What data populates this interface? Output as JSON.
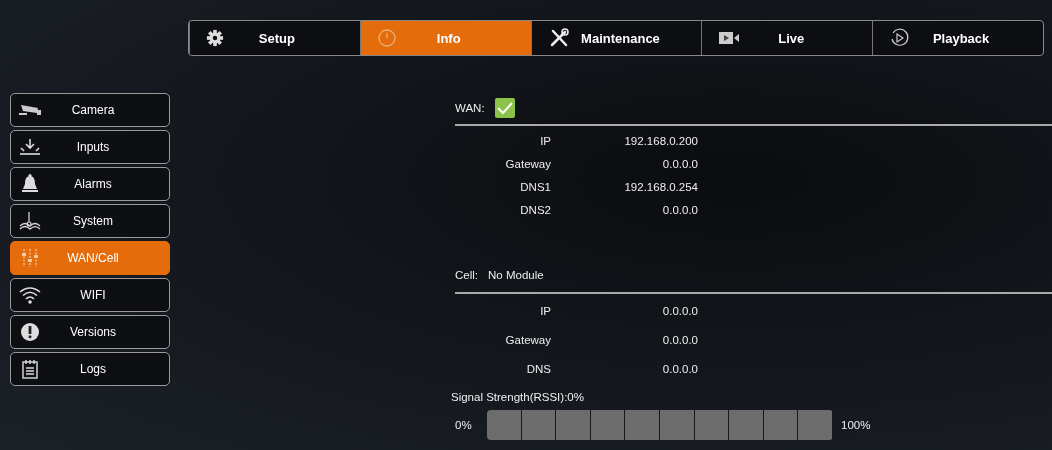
{
  "tabs": [
    {
      "label": "Setup",
      "selected": false
    },
    {
      "label": "Info",
      "selected": true
    },
    {
      "label": "Maintenance",
      "selected": false
    },
    {
      "label": "Live",
      "selected": false
    },
    {
      "label": "Playback",
      "selected": false
    }
  ],
  "sidebar": {
    "items": [
      {
        "label": "Camera",
        "selected": false
      },
      {
        "label": "Inputs",
        "selected": false
      },
      {
        "label": "Alarms",
        "selected": false
      },
      {
        "label": "System",
        "selected": false
      },
      {
        "label": "WAN/Cell",
        "selected": true
      },
      {
        "label": "WIFI",
        "selected": false
      },
      {
        "label": "Versions",
        "selected": false
      },
      {
        "label": "Logs",
        "selected": false
      }
    ]
  },
  "wan": {
    "label": "WAN:",
    "connected": true,
    "rows": [
      {
        "name": "IP",
        "value": "192.168.0.200"
      },
      {
        "name": "Gateway",
        "value": "0.0.0.0"
      },
      {
        "name": "DNS1",
        "value": "192.168.0.254"
      },
      {
        "name": "DNS2",
        "value": "0.0.0.0"
      }
    ]
  },
  "cell": {
    "label": "Cell:",
    "status": "No Module",
    "rows": [
      {
        "name": "IP",
        "value": "0.0.0.0"
      },
      {
        "name": "Gateway",
        "value": "0.0.0.0"
      },
      {
        "name": "DNS",
        "value": "0.0.0.0"
      }
    ],
    "signal": {
      "label": "Signal Strength(RSSI):0%",
      "min": "0%",
      "max": "100%",
      "level": 0
    }
  }
}
